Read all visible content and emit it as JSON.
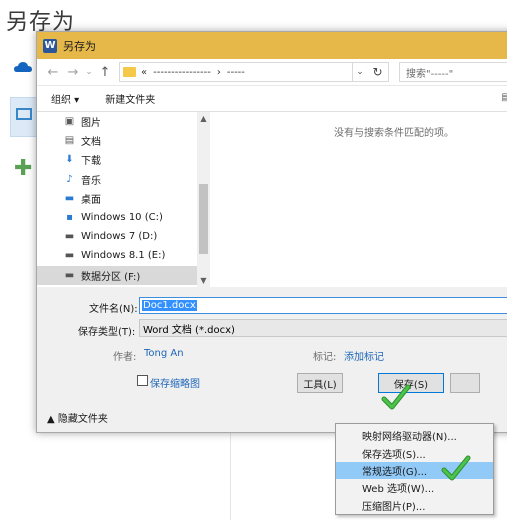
{
  "page_heading": "另存为",
  "dialog": {
    "title": "另存为",
    "app_icon_letter": "W",
    "nav": {
      "back": "←",
      "forward": "→",
      "recent": "⌄",
      "up": "↑"
    },
    "address": {
      "prefix": "«",
      "segment1": "----------------",
      "sep": "›",
      "segment2": "-----",
      "refresh": "↻",
      "dropdown": "⌄"
    },
    "search_placeholder": "搜索\"-----\"",
    "toolbar": {
      "organize": "组织 ▾",
      "new_folder": "新建文件夹",
      "view_glyph": "▤"
    },
    "nav_items": [
      {
        "label": "图片",
        "icon": "pictures-icon",
        "glyph": "▣",
        "color": "#5a5a5a"
      },
      {
        "label": "文档",
        "icon": "documents-icon",
        "glyph": "▤",
        "color": "#5a5a5a"
      },
      {
        "label": "下载",
        "icon": "downloads-icon",
        "glyph": "⬇",
        "color": "#2b7bd4"
      },
      {
        "label": "音乐",
        "icon": "music-icon",
        "glyph": "♪",
        "color": "#2b7bd4"
      },
      {
        "label": "桌面",
        "icon": "desktop-icon",
        "glyph": "▬",
        "color": "#2b7bd4"
      },
      {
        "label": "Windows 10 (C:)",
        "icon": "windows-drive-icon",
        "glyph": "▪",
        "color": "#2b7bd4"
      },
      {
        "label": "Windows 7 (D:)",
        "icon": "drive-icon",
        "glyph": "▬",
        "color": "#555555"
      },
      {
        "label": "Windows 8.1 (E:)",
        "icon": "drive-icon",
        "glyph": "▬",
        "color": "#555555"
      },
      {
        "label": "数据分区 (F:)",
        "icon": "drive-icon",
        "glyph": "▬",
        "color": "#555555"
      }
    ],
    "scroll_up": "▲",
    "scroll_down": "▼",
    "empty_message": "没有与搜索条件匹配的项。",
    "form": {
      "filename_label": "文件名(N):",
      "filename_value": "Doc1.docx",
      "filetype_label": "保存类型(T):",
      "filetype_value": "Word 文档 (*.docx)",
      "author_label": "作者:",
      "author_value": "Tong An",
      "tags_label": "标记:",
      "tags_value": "添加标记",
      "thumbnail_label": "保存缩略图",
      "hide_folders": "▲ 隐藏文件夹"
    },
    "buttons": {
      "tools": "工具(L)",
      "save": "保存(S)",
      "cancel": ""
    }
  },
  "tools_menu": {
    "items": [
      "映射网络驱动器(N)...",
      "保存选项(S)...",
      "常规选项(G)...",
      "Web 选项(W)...",
      "压缩图片(P)..."
    ],
    "highlighted_index": 2
  },
  "colors": {
    "titlebar": "#e6b84a",
    "check": "#3aa83a",
    "highlight": "#91c9f7",
    "link": "#1e66b8"
  }
}
